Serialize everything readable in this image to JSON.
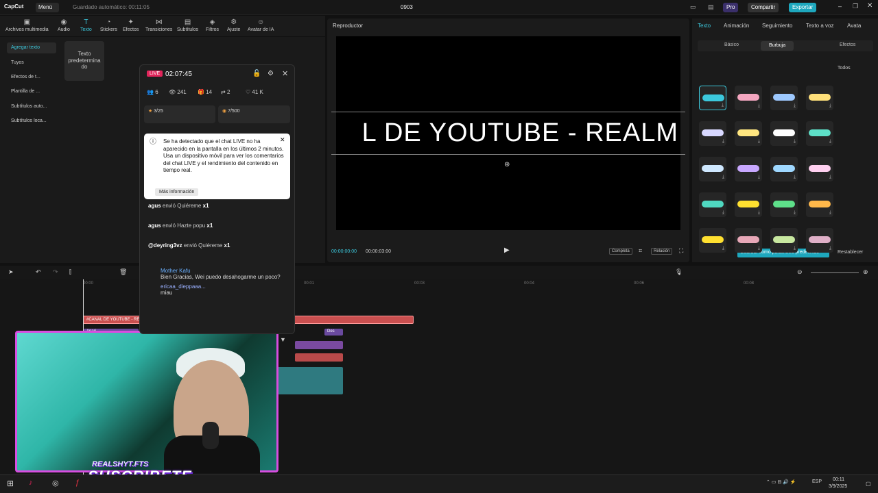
{
  "titlebar": {
    "app": "CapCut",
    "menu": "Menú",
    "autosave": "Guardado automático: 00:11:05",
    "project": "0903",
    "pro": "Pro",
    "share": "Compartir",
    "export": "Exportar"
  },
  "toolbar": {
    "items": [
      {
        "label": "Archivos multimedia",
        "icon": "media-icon"
      },
      {
        "label": "Audio",
        "icon": "audio-icon"
      },
      {
        "label": "Texto",
        "icon": "text-icon"
      },
      {
        "label": "Stickers",
        "icon": "sticker-icon"
      },
      {
        "label": "Efectos",
        "icon": "effects-icon"
      },
      {
        "label": "Transiciones",
        "icon": "transition-icon"
      },
      {
        "label": "Subtítulos",
        "icon": "subtitles-icon"
      },
      {
        "label": "Filtros",
        "icon": "filter-icon"
      },
      {
        "label": "Ajuste",
        "icon": "adjust-icon"
      },
      {
        "label": "Avatar de IA",
        "icon": "avatar-icon"
      }
    ]
  },
  "sidebar": {
    "items": [
      "Agregar texto",
      "Tuyos",
      "Efectos de t...",
      "Plantilla de ...",
      "Subtítulos auto...",
      "Subtítulos loca..."
    ]
  },
  "preset": {
    "label": "Texto predetermina do"
  },
  "player": {
    "title": "Reproductor",
    "video_text": "L DE YOUTUBE - REALM",
    "time_current": "00:00:00:00",
    "time_total": "00:00:03:00",
    "full_label": "Completa",
    "ratio_label": "Relación"
  },
  "right_panel": {
    "tabs": [
      "Texto",
      "Animación",
      "Seguimiento",
      "Texto a voz",
      "Avata"
    ],
    "subtabs": [
      "Básico",
      "Burbuja",
      "Efectos"
    ],
    "filter": "Todos",
    "save_preset": "Guardar como parámetro predefinido",
    "reset": "Restablecer"
  },
  "timeline": {
    "ticks": [
      "00:00",
      "00:01",
      "00:03",
      "00:04",
      "00:06",
      "00:08"
    ],
    "text_clip": "#CANAL DE YOUTUBE - REALMSHYT",
    "clip2": "Apari",
    "clip3": "Des"
  },
  "live": {
    "badge": "LIVE",
    "time": "02:07:45",
    "stats": [
      "6",
      "241",
      "14",
      "2",
      "41 K"
    ],
    "goal1": "3/25",
    "goal2": "7/500",
    "notice": "Se ha detectado que el chat LIVE no ha aparecido en la pantalla en los últimos 2 minutos. Usa un dispositivo móvil para ver los comentarios del chat LIVE y el rendimiento del contenido en tiempo real.",
    "more": "Más información",
    "gifts": [
      {
        "user": "agus",
        "text": "envió Quiéreme",
        "count": "x1"
      },
      {
        "user": "agus",
        "text": "envió Hazte popu",
        "count": "x1"
      },
      {
        "user": "@deyring3vz",
        "text": "envió Quiéreme",
        "count": "x1"
      }
    ],
    "comment_user": "Mother Kafu",
    "comment_text": "Bien Gracias, Wei puedo desahogarme un poco?",
    "comment2_user": "ericaa_dieppaaa...",
    "comment2_text": "miau"
  },
  "overlay": {
    "channel": "REALSHYT.FTS",
    "subscribe": "SUSCRIBETE"
  },
  "taskbar": {
    "lang": "ESP",
    "time": "00:11",
    "date": "3/9/2025"
  }
}
